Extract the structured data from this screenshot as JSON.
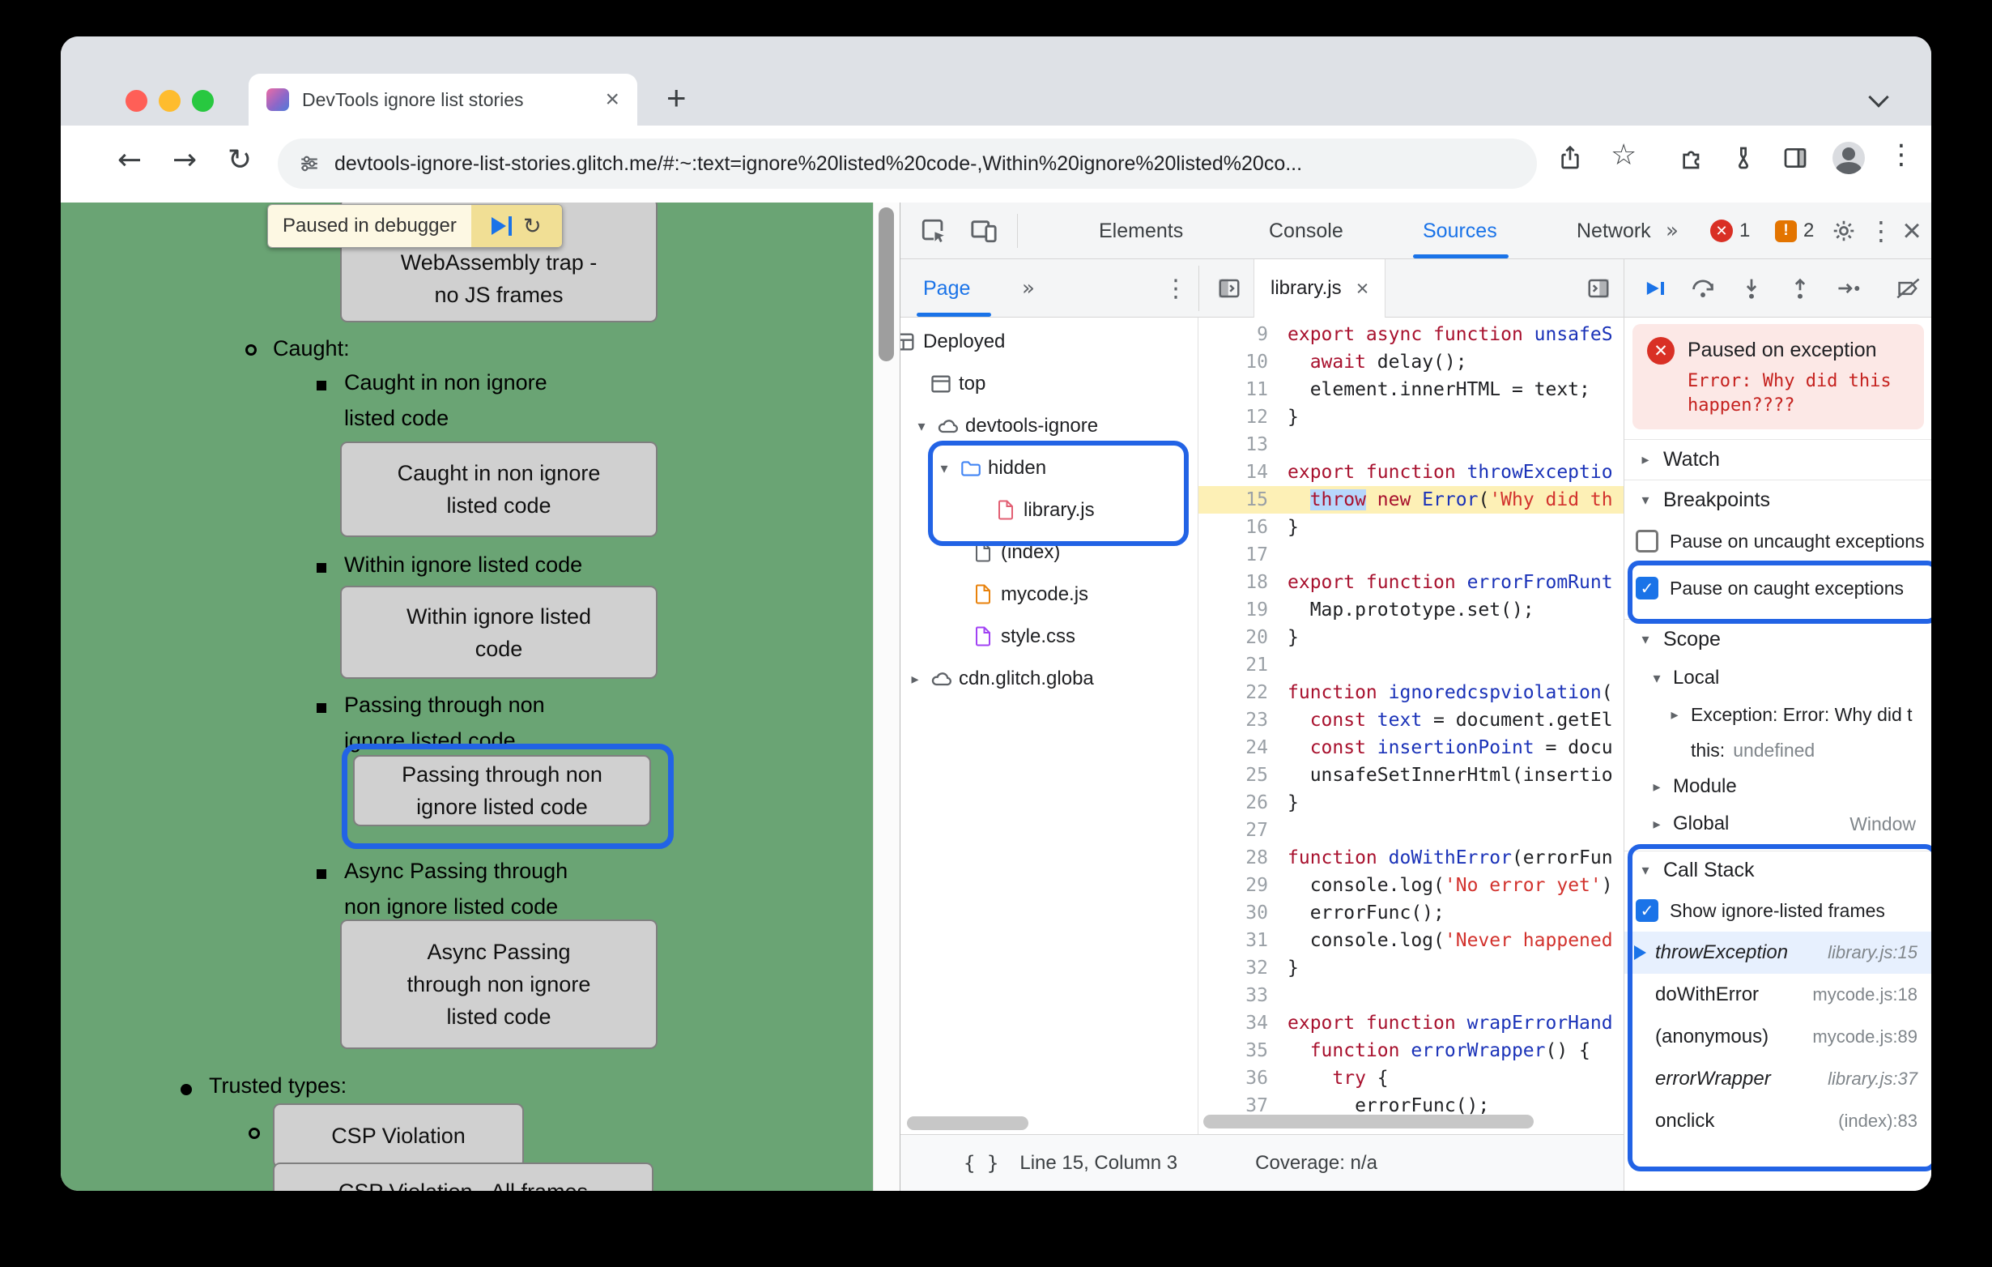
{
  "icons": {
    "back": "←",
    "forward": "→",
    "reload": "↻",
    "star": "☆",
    "more": "»",
    "dots": "⋮",
    "close": "×",
    "check": "✓",
    "caret_open": "▾",
    "caret_closed": "▸",
    "braces": "{ }",
    "step": "↻",
    "plus": "+",
    "error_x": "✕",
    "issue_mark": "!"
  },
  "browser": {
    "tab_title": "DevTools ignore list stories",
    "url": "devtools-ignore-list-stories.glitch.me/#:~:text=ignore%20listed%20code-,Within%20ignore%20listed%20co..."
  },
  "page": {
    "debugger_banner": {
      "label": "Paused in debugger"
    },
    "labels": {
      "caught": "Caught:",
      "caught_item": "Caught in non ignore\nlisted code",
      "within_item": "Within ignore listed code",
      "passing_item": "Passing through non\nignore listed code",
      "async_item": "Async Passing through\nnon ignore listed code",
      "trusted": "Trusted types:"
    },
    "buttons": {
      "wasm": "WebAssembly trap -\nno JS frames",
      "caught": "Caught in non ignore\nlisted code",
      "within": "Within ignore listed\ncode",
      "passing": "Passing through non\nignore listed code",
      "async_passing": "Async Passing\nthrough non ignore\nlisted code",
      "csp": "CSP Violation",
      "csp_frames": "CSP Violation - All frames"
    }
  },
  "devtools": {
    "tabs": {
      "elements": "Elements",
      "console": "Console",
      "sources": "Sources",
      "network": "Network"
    },
    "badges": {
      "errors": "1",
      "issues": "2"
    },
    "navigator": {
      "tab_label": "Page",
      "tree": {
        "deployed": "Deployed",
        "top": "top",
        "origin": "devtools-ignore",
        "hidden": "hidden",
        "library": "library.js",
        "index": "(index)",
        "mycode": "mycode.js",
        "style": "style.css",
        "cdn": "cdn.glitch.globa"
      }
    },
    "editor_tab": {
      "label": "library.js"
    },
    "editor": {
      "paused_line": 15,
      "lines": [
        {
          "n": 9,
          "seg": [
            [
              "k",
              "export async function "
            ],
            [
              "d",
              "unsafeS"
            ]
          ]
        },
        {
          "n": 10,
          "seg": [
            [
              "p",
              "  "
            ],
            [
              "k",
              "await"
            ],
            [
              "p",
              " delay();"
            ]
          ]
        },
        {
          "n": 11,
          "seg": [
            [
              "p",
              "  element.innerHTML = text;"
            ]
          ]
        },
        {
          "n": 12,
          "seg": [
            [
              "p",
              "}"
            ]
          ]
        },
        {
          "n": 13,
          "seg": []
        },
        {
          "n": 14,
          "seg": [
            [
              "k",
              "export function "
            ],
            [
              "d",
              "throwExceptio"
            ]
          ]
        },
        {
          "n": 15,
          "seg": [
            [
              "p",
              "  "
            ],
            [
              "kh",
              "throw"
            ],
            [
              "k",
              " new "
            ],
            [
              "d",
              "Error"
            ],
            [
              "p",
              "("
            ],
            [
              "s",
              "'Why did th"
            ]
          ]
        },
        {
          "n": 16,
          "seg": [
            [
              "p",
              "}"
            ]
          ]
        },
        {
          "n": 17,
          "seg": []
        },
        {
          "n": 18,
          "seg": [
            [
              "k",
              "export function "
            ],
            [
              "d",
              "errorFromRunt"
            ]
          ]
        },
        {
          "n": 19,
          "seg": [
            [
              "p",
              "  Map.prototype.set();"
            ]
          ]
        },
        {
          "n": 20,
          "seg": [
            [
              "p",
              "}"
            ]
          ]
        },
        {
          "n": 21,
          "seg": []
        },
        {
          "n": 22,
          "seg": [
            [
              "k",
              "function "
            ],
            [
              "d",
              "ignoredcspviolation"
            ],
            [
              "p",
              "("
            ]
          ]
        },
        {
          "n": 23,
          "seg": [
            [
              "p",
              "  "
            ],
            [
              "k",
              "const "
            ],
            [
              "d",
              "text"
            ],
            [
              "p",
              " = document.getEl"
            ]
          ]
        },
        {
          "n": 24,
          "seg": [
            [
              "p",
              "  "
            ],
            [
              "k",
              "const "
            ],
            [
              "d",
              "insertionPoint"
            ],
            [
              "p",
              " = docu"
            ]
          ]
        },
        {
          "n": 25,
          "seg": [
            [
              "p",
              "  unsafeSetInnerHtml(insertio"
            ]
          ]
        },
        {
          "n": 26,
          "seg": [
            [
              "p",
              "}"
            ]
          ]
        },
        {
          "n": 27,
          "seg": []
        },
        {
          "n": 28,
          "seg": [
            [
              "k",
              "function "
            ],
            [
              "d",
              "doWithError"
            ],
            [
              "p",
              "(errorFun"
            ]
          ]
        },
        {
          "n": 29,
          "seg": [
            [
              "p",
              "  console.log("
            ],
            [
              "s",
              "'No error yet'"
            ],
            [
              "p",
              ")"
            ]
          ]
        },
        {
          "n": 30,
          "seg": [
            [
              "p",
              "  errorFunc();"
            ]
          ]
        },
        {
          "n": 31,
          "seg": [
            [
              "p",
              "  console.log("
            ],
            [
              "s",
              "'Never happened"
            ]
          ]
        },
        {
          "n": 32,
          "seg": [
            [
              "p",
              "}"
            ]
          ]
        },
        {
          "n": 33,
          "seg": []
        },
        {
          "n": 34,
          "seg": [
            [
              "k",
              "export function "
            ],
            [
              "d",
              "wrapErrorHand"
            ]
          ]
        },
        {
          "n": 35,
          "seg": [
            [
              "p",
              "  "
            ],
            [
              "k",
              "function "
            ],
            [
              "d",
              "errorWrapper"
            ],
            [
              "p",
              "() {"
            ]
          ]
        },
        {
          "n": 36,
          "seg": [
            [
              "p",
              "    "
            ],
            [
              "k",
              "try"
            ],
            [
              "p",
              " {"
            ]
          ]
        },
        {
          "n": 37,
          "seg": [
            [
              "p",
              "      errorFunc();"
            ]
          ]
        }
      ]
    },
    "status_bar": {
      "position": "Line 15, Column 3",
      "coverage": "Coverage: n/a"
    },
    "sidebar": {
      "paused_message": {
        "title": "Paused on exception",
        "error": "Error: Why did this\nhappen????"
      },
      "watch": {
        "title": "Watch"
      },
      "breakpoints": {
        "title": "Breakpoints",
        "uncaught": {
          "label": "Pause on uncaught exceptions",
          "checked": false
        },
        "caught": {
          "label": "Pause on caught exceptions",
          "checked": true
        }
      },
      "scope": {
        "title": "Scope",
        "local_label": "Local",
        "exception": "Exception: Error: Why did t",
        "this_name": "this:",
        "this_value": "undefined",
        "module_label": "Module",
        "global_label": "Global",
        "global_value": "Window"
      },
      "call_stack": {
        "title": "Call Stack",
        "toggle_label": "Show ignore-listed frames",
        "frames": [
          {
            "name": "throwException",
            "location": "library.js:15",
            "italic": true,
            "active": true
          },
          {
            "name": "doWithError",
            "location": "mycode.js:18",
            "italic": false,
            "active": false
          },
          {
            "name": "(anonymous)",
            "location": "mycode.js:89",
            "italic": false,
            "active": false
          },
          {
            "name": "errorWrapper",
            "location": "library.js:37",
            "italic": true,
            "active": false
          },
          {
            "name": "onclick",
            "location": "(index):83",
            "italic": false,
            "active": false
          }
        ]
      }
    },
    "colors": {
      "accent_blue": "#1a73e8",
      "annotation_blue": "#2263e5",
      "error_red": "#d93025",
      "issues_orange": "#e37400"
    }
  }
}
